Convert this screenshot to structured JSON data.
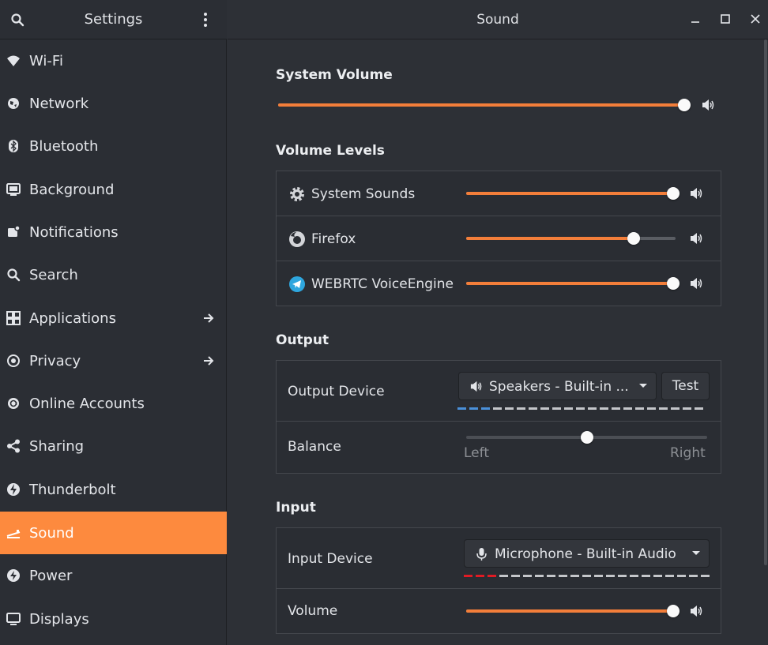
{
  "sidebar": {
    "title": "Settings",
    "items": [
      {
        "label": "Wi-Fi",
        "icon": "wifi-icon"
      },
      {
        "label": "Network",
        "icon": "network-icon"
      },
      {
        "label": "Bluetooth",
        "icon": "bluetooth-icon"
      },
      {
        "label": "Background",
        "icon": "background-icon"
      },
      {
        "label": "Notifications",
        "icon": "notifications-icon"
      },
      {
        "label": "Search",
        "icon": "search-icon"
      },
      {
        "label": "Applications",
        "icon": "applications-icon"
      },
      {
        "label": "Privacy",
        "icon": "privacy-icon"
      },
      {
        "label": "Online Accounts",
        "icon": "online-accounts-icon"
      },
      {
        "label": "Sharing",
        "icon": "sharing-icon"
      },
      {
        "label": "Thunderbolt",
        "icon": "thunderbolt-icon"
      },
      {
        "label": "Sound",
        "icon": "sound-icon"
      },
      {
        "label": "Power",
        "icon": "power-icon"
      },
      {
        "label": "Displays",
        "icon": "displays-icon"
      }
    ],
    "active": "Sound"
  },
  "header": {
    "title": "Sound"
  },
  "system_volume": {
    "title": "System Volume",
    "level": 1.0
  },
  "volume_levels": {
    "title": "Volume Levels",
    "apps": [
      {
        "label": "System Sounds",
        "icon": "gear-icon",
        "level": 1.0
      },
      {
        "label": "Firefox",
        "icon": "firefox-icon",
        "level": 0.8
      },
      {
        "label": "WEBRTC VoiceEngine",
        "icon": "telegram-icon",
        "level": 1.0
      }
    ]
  },
  "output": {
    "title": "Output",
    "device_label": "Output Device",
    "device_value": "Speakers - Built-in ...",
    "test_label": "Test",
    "balance_label": "Balance",
    "balance_left": "Left",
    "balance_right": "Right",
    "balance_value": 0.5
  },
  "input": {
    "title": "Input",
    "device_label": "Input Device",
    "device_value": "Microphone - Built-in Audio",
    "volume_label": "Volume",
    "volume_level": 1.0
  },
  "colors": {
    "accent": "#fd8a3e",
    "slider_fill": "#f37e3a",
    "output_level": "#4a90d9",
    "input_level": "#e01b24"
  }
}
